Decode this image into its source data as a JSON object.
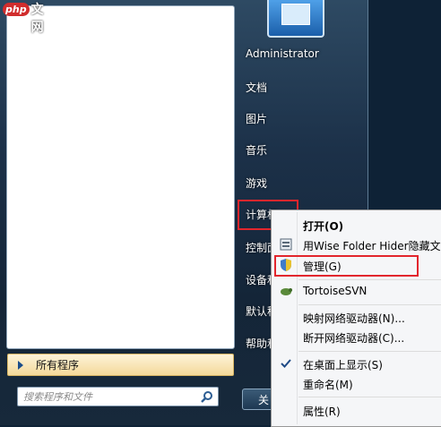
{
  "logo": {
    "php": "php",
    "site": "中文网"
  },
  "start_menu": {
    "all_programs": "所有程序",
    "search_placeholder": "搜索程序和文件",
    "user_name": "Administrator",
    "right_items": [
      "文档",
      "图片",
      "音乐",
      "游戏",
      "计算机",
      "控制面",
      "设备和",
      "默认程",
      "帮助和"
    ],
    "shutdown_label": "关"
  },
  "context_menu": {
    "items": [
      {
        "label": "打开(O)",
        "bold": true
      },
      {
        "label": "用Wise Folder Hider隐藏文"
      },
      {
        "label": "管理(G)"
      },
      {
        "label": "TortoiseSVN"
      },
      {
        "label": "映射网络驱动器(N)..."
      },
      {
        "label": "断开网络驱动器(C)..."
      },
      {
        "label": "在桌面上显示(S)",
        "checked": true
      },
      {
        "label": "重命名(M)"
      },
      {
        "label": "属性(R)"
      }
    ]
  },
  "colors": {
    "highlight": "#e2262d",
    "accent": "#1b4d8a"
  }
}
